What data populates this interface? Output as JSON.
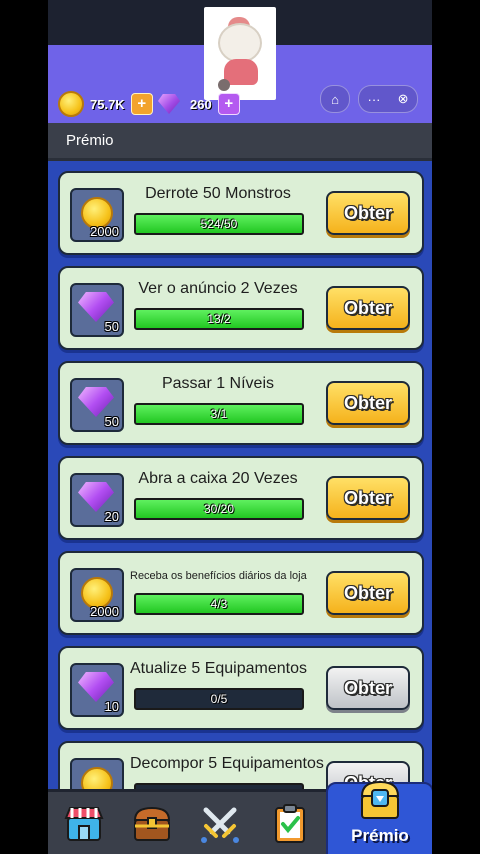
{
  "currency": {
    "coins": "75.7K",
    "gems": "260",
    "coins_plus": "+",
    "gems_plus": "+"
  },
  "window_controls": {
    "home_icon": "⌂",
    "more_icon": "···",
    "close_icon": "⊗"
  },
  "section": {
    "title": "Prémio"
  },
  "tasks": [
    {
      "title": "Derrote 50 Monstros",
      "reward_type": "coin",
      "reward": "2000",
      "progress": "524/50",
      "fill": 1.0,
      "button": "Obter",
      "button_state": "ready"
    },
    {
      "title": "Ver o anúncio 2 Vezes",
      "reward_type": "gem",
      "reward": "50",
      "progress": "13/2",
      "fill": 1.0,
      "button": "Obter",
      "button_state": "ready"
    },
    {
      "title": "Passar 1 Níveis",
      "reward_type": "gem",
      "reward": "50",
      "progress": "3/1",
      "fill": 1.0,
      "button": "Obter",
      "button_state": "ready"
    },
    {
      "title": "Abra a caixa 20 Vezes",
      "reward_type": "gem",
      "reward": "20",
      "progress": "30/20",
      "fill": 1.0,
      "button": "Obter",
      "button_state": "ready"
    },
    {
      "title": "Receba os benefícios diários da loja",
      "reward_type": "coin",
      "reward": "2000",
      "progress": "4/3",
      "fill": 1.0,
      "button": "Obter",
      "button_state": "ready"
    },
    {
      "title": "Atualize 5 Equipamentos",
      "reward_type": "gem",
      "reward": "10",
      "progress": "0/5",
      "fill": 0.0,
      "button": "Obter",
      "button_state": "disabled"
    },
    {
      "title": "Decompor 5 Equipamentos",
      "reward_type": "coin",
      "reward": "",
      "progress": "",
      "fill": 0.0,
      "button": "Obter",
      "button_state": "disabled"
    }
  ],
  "tabbar": {
    "tabs": [
      {
        "icon": "shop-icon"
      },
      {
        "icon": "chest-icon"
      },
      {
        "icon": "battle-swords-icon"
      },
      {
        "icon": "clipboard-tasks-icon"
      }
    ],
    "active_label": "Prémio"
  },
  "colors": {
    "hero_bg": "#6f63e8",
    "list_bg": "#2a49b8",
    "card_bg": "#dcefd6",
    "button_ready": "#f5b21c",
    "button_disabled": "#bfc3c8",
    "progress_fill": "#22c722"
  }
}
